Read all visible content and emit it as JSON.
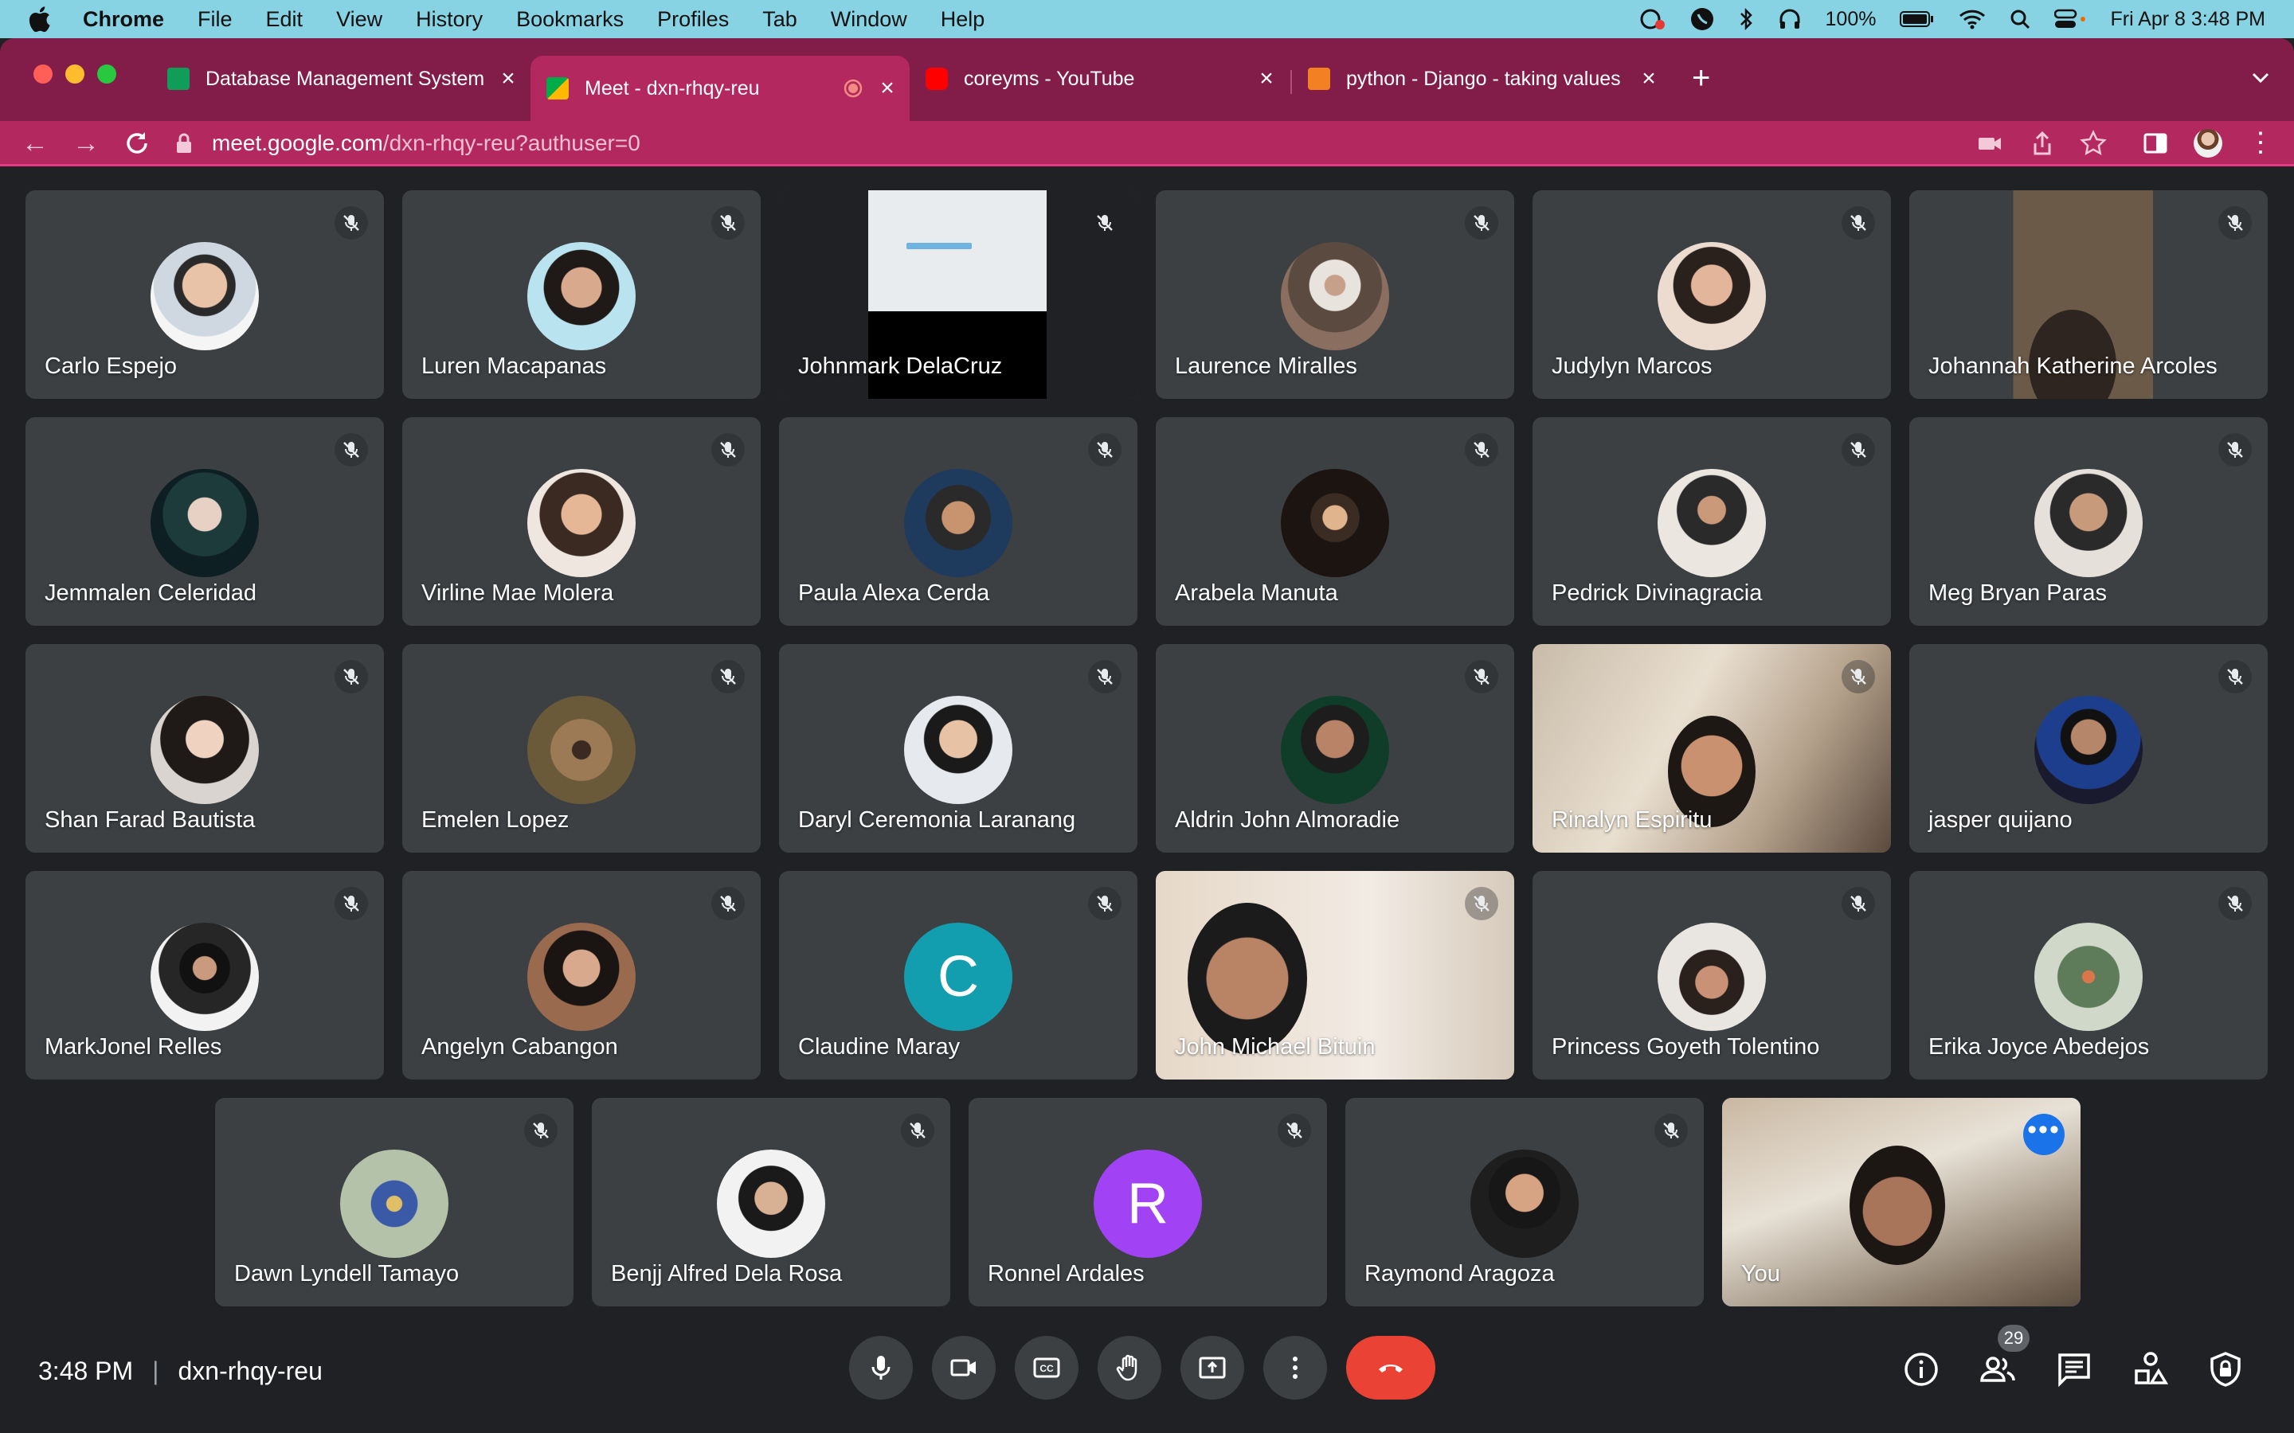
{
  "menubar": {
    "app_name": "Chrome",
    "items": [
      "File",
      "Edit",
      "View",
      "History",
      "Bookmarks",
      "Profiles",
      "Tab",
      "Window",
      "Help"
    ],
    "battery": "100%",
    "datetime": "Fri Apr 8  3:48 PM"
  },
  "tabs": [
    {
      "title": "Database Management System",
      "favicon_color": "#0f9d58"
    },
    {
      "title": "Meet - dxn-rhqy-reu",
      "favicon_color": "#00832d",
      "active": true
    },
    {
      "title": "coreyms - YouTube",
      "favicon_color": "#ff0000"
    },
    {
      "title": "python - Django - taking values",
      "favicon_color": "#f48024"
    }
  ],
  "address": {
    "host": "meet.google.com",
    "path": "/dxn-rhqy-reu?authuser=0"
  },
  "participants": [
    {
      "name": "Carlo Espejo"
    },
    {
      "name": "Luren Macapanas"
    },
    {
      "name": "Johnmark DelaCruz"
    },
    {
      "name": "Laurence Miralles"
    },
    {
      "name": "Judylyn Marcos"
    },
    {
      "name": "Johannah Katherine Arcoles"
    },
    {
      "name": "Jemmalen Celeridad"
    },
    {
      "name": "Virline Mae Molera"
    },
    {
      "name": "Paula Alexa Cerda"
    },
    {
      "name": "Arabela Manuta"
    },
    {
      "name": "Pedrick Divinagracia"
    },
    {
      "name": "Meg Bryan Paras"
    },
    {
      "name": "Shan Farad Bautista"
    },
    {
      "name": "Emelen Lopez"
    },
    {
      "name": "Daryl Ceremonia Laranang"
    },
    {
      "name": "Aldrin John Almoradie"
    },
    {
      "name": "Rinalyn Espiritu"
    },
    {
      "name": "jasper quijano"
    },
    {
      "name": "MarkJonel Relles"
    },
    {
      "name": "Angelyn Cabangon"
    },
    {
      "name": "Claudine Maray",
      "letter": "C",
      "color": "#129eaf"
    },
    {
      "name": "John Michael Bituin"
    },
    {
      "name": "Princess Goyeth Tolentino"
    },
    {
      "name": "Erika Joyce Abedejos"
    },
    {
      "name": "Dawn Lyndell Tamayo"
    },
    {
      "name": "Benjj Alfred Dela Rosa"
    },
    {
      "name": "Ronnel Ardales",
      "letter": "R",
      "color": "#a142f4"
    },
    {
      "name": "Raymond Aragoza"
    },
    {
      "name": "You"
    }
  ],
  "bottom": {
    "time": "3:48 PM",
    "meeting_code": "dxn-rhqy-reu",
    "people_count": "29"
  },
  "colors": {
    "tab_bar": "#821d4a",
    "active_tab": "#b3285f",
    "hangup": "#ea4335",
    "tile": "#3c4043",
    "background": "#202124"
  }
}
